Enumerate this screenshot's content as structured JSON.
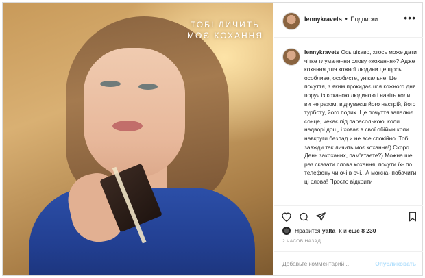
{
  "photo": {
    "slogan_line1": "ТОБІ ЛИЧИТЬ",
    "slogan_line2": "МОЄ КОХАННЯ"
  },
  "header": {
    "username": "lennykravets",
    "separator": "•",
    "follow_label": "Подписки",
    "more_icon": "more-dots-icon"
  },
  "caption": {
    "username": "lennykravets",
    "text": "Ось цікаво, хтось може дати чітке тлумачення слову «кохання»? Адже кохання для кожної людини це щось особливе, особисте, унікальне. Це почуття, з яким прокидаєшся кожного дня поруч із коханою людиною і навіть коли ви не разом, відчуваєш його настрій, його турботу, його подих. Це почуття запалює сонце, чекає під парасолькою, коли надворі дощ, і ховає в свої обійми коли навкруги безлад и не все спокійно. Тобі завжди так личить моє кохання!) Скоро День закоханих, пам'ятаєте?) Можна ще раз сказати слова кохання, почути їх- по телефону чи очі в очі.. А можна- побачити ці слова! Просто відкрити"
  },
  "actions": {
    "like_icon": "heart-icon",
    "comment_icon": "comment-icon",
    "share_icon": "share-icon",
    "save_icon": "bookmark-icon"
  },
  "likes": {
    "prefix": "Нравится",
    "user": "yalta_k",
    "conj": "и",
    "more": "ещё 8 230"
  },
  "time": "2 ЧАСОВ НАЗАД",
  "comment": {
    "placeholder": "Добавьте комментарий...",
    "publish_label": "Опубликовать"
  }
}
